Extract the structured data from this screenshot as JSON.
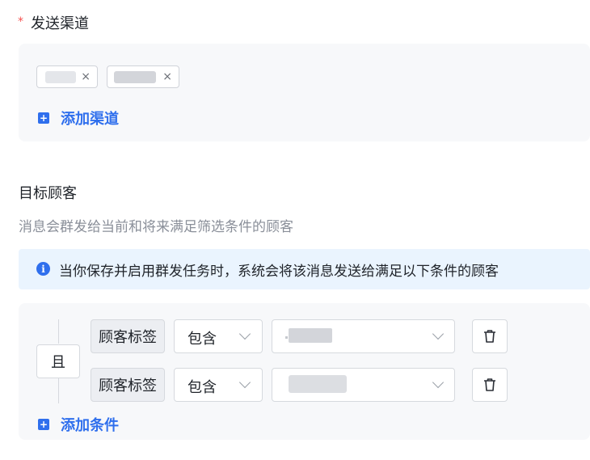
{
  "channel_section": {
    "required_mark": "*",
    "label": "发送渠道",
    "chips": [
      {
        "remove_icon": "×"
      },
      {
        "remove_icon": "×"
      }
    ],
    "add_label": "添加渠道",
    "add_icon": "plus-square-icon"
  },
  "target_section": {
    "label": "目标顾客",
    "description": "消息会群发给当前和将来满足筛选条件的顾客",
    "info_icon": "i",
    "info_text": "当你保存并启用群发任务时，系统会将该消息发送给满足以下条件的顾客",
    "logic_operator": "且",
    "conditions": [
      {
        "field": "顾客标签",
        "operator": "包含",
        "delete_icon": "trash-icon"
      },
      {
        "field": "顾客标签",
        "operator": "包含",
        "delete_icon": "trash-icon"
      }
    ],
    "add_condition_label": "添加条件",
    "add_icon": "plus-square-icon"
  },
  "colors": {
    "accent": "#2f6fed",
    "required": "#f5504f",
    "panel_bg": "#f7f8fa",
    "info_bg": "#eaf4fe"
  }
}
